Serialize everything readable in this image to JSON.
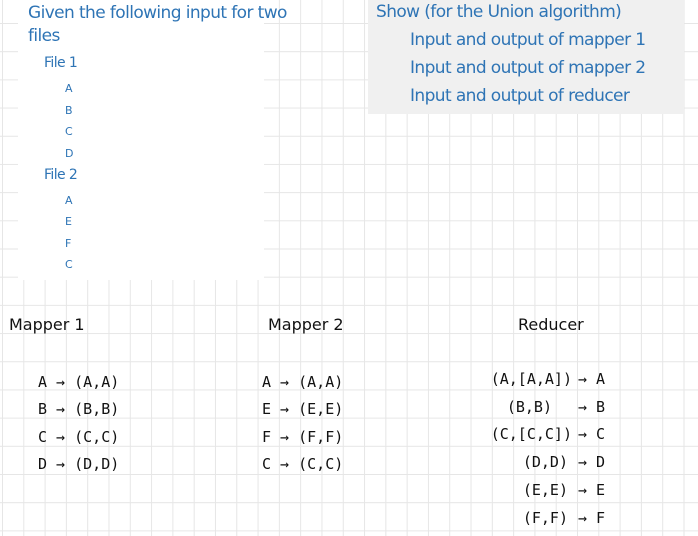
{
  "question": {
    "intro_line1": "Given the following input for two",
    "intro_line2": "files",
    "files": [
      {
        "label": "File 1",
        "items": [
          "A",
          "B",
          "C",
          "D"
        ]
      },
      {
        "label": "File 2",
        "items": [
          "A",
          "E",
          "F",
          "C"
        ]
      }
    ],
    "task_title": "Show (for the Union algorithm)",
    "tasks": [
      "Input and output of mapper 1",
      "Input and output of mapper 2",
      "Input and output of reducer"
    ]
  },
  "handwritten": {
    "mapper1": {
      "title": "Mapper 1",
      "rows": [
        "A → (A,A)",
        "B → (B,B)",
        "C → (C,C)",
        "D → (D,D)"
      ]
    },
    "mapper2": {
      "title": "Mapper 2",
      "rows": [
        "A → (A,A)",
        "E → (E,E)",
        "F → (F,F)",
        "C → (C,C)"
      ]
    },
    "reducer": {
      "title": "Reducer",
      "rows": [
        {
          "input": "(A,[A,A])",
          "output": "→ A"
        },
        {
          "input": "(B,B)",
          "output": "→ B"
        },
        {
          "input": "(C,[C,C])",
          "output": "→ C"
        },
        {
          "input": "(D,D)",
          "output": "→ D"
        },
        {
          "input": "(E,E)",
          "output": "→ E"
        },
        {
          "input": "(F,F)",
          "output": "→ F"
        }
      ]
    }
  }
}
